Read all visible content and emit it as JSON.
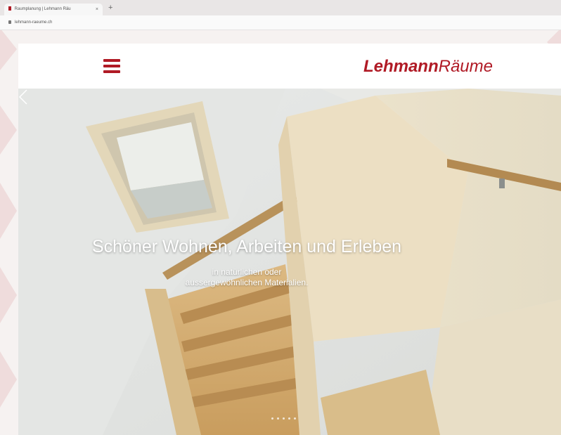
{
  "browser": {
    "tab_title": "Raumplanung | Lehmann Räu",
    "tab_close": "×",
    "new_tab": "+",
    "url": "lehmann-raeume.ch"
  },
  "header": {
    "menu_icon": "hamburger-menu-icon",
    "logo_bold": "Lehmann",
    "logo_light": "Räume",
    "brand_color": "#b01a25"
  },
  "hero": {
    "title": "Schöner Wohnen, Arbeiten und Erleben",
    "subtitle": "in natürlichen oder aussergewöhnlichen Materialien.",
    "prev_icon": "chevron-left-icon",
    "slide_count": 5,
    "active_slide": 1
  }
}
